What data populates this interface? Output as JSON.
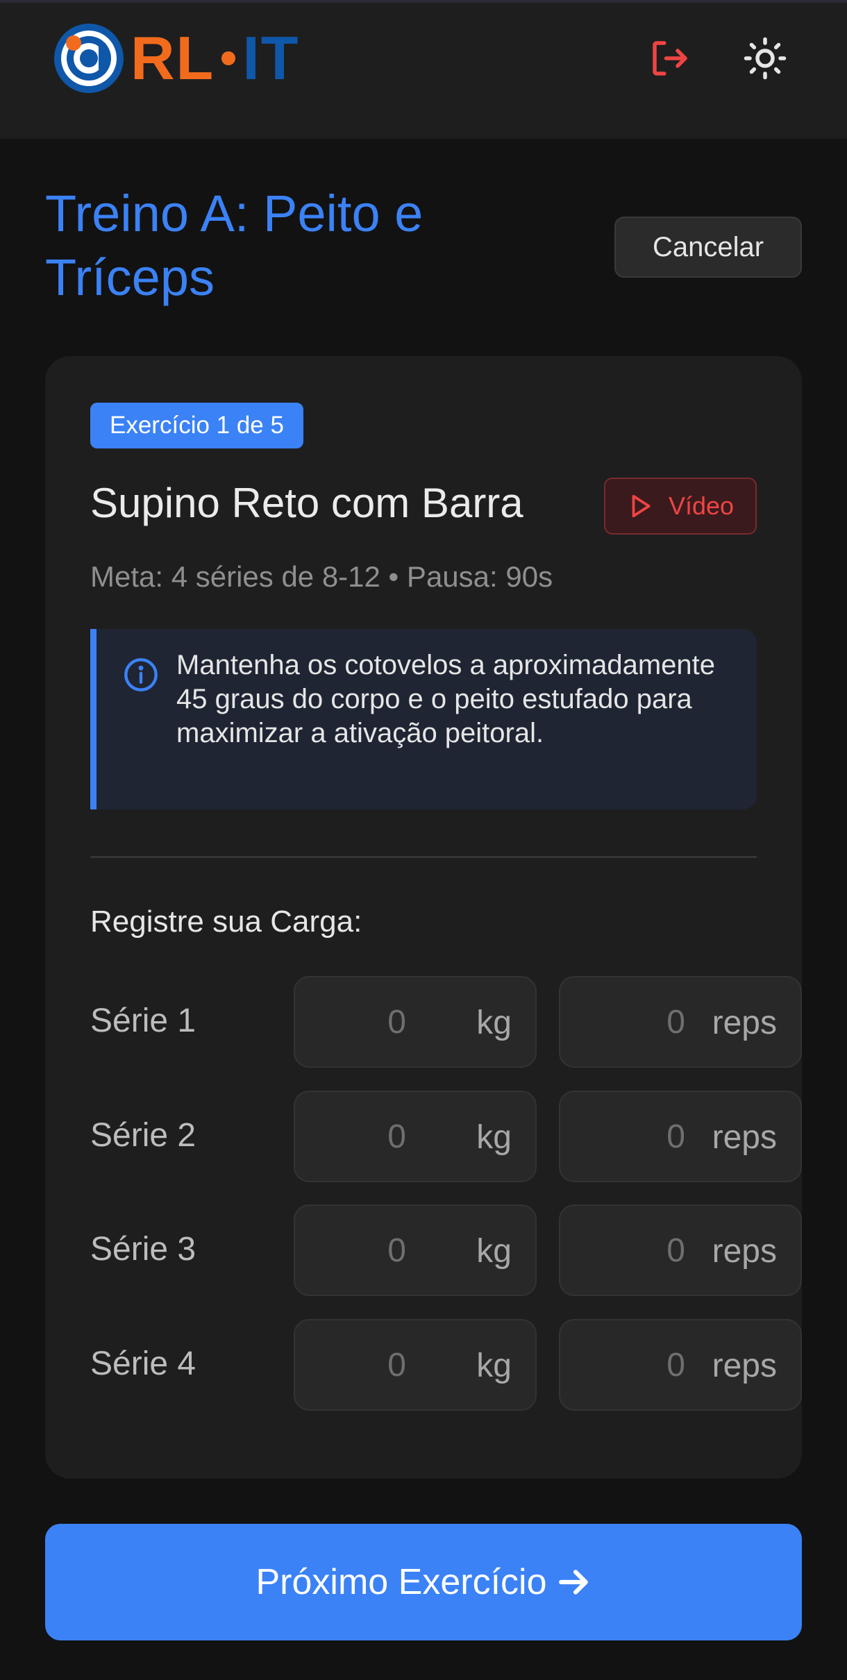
{
  "header": {
    "logo_prefix": "RL",
    "logo_suffix": "IT",
    "logout_icon": "logout-icon",
    "theme_icon": "sun-icon"
  },
  "page": {
    "title_line1": "Treino A: Peito e",
    "title_line2": "Tríceps",
    "cancel_label": "Cancelar"
  },
  "exercise": {
    "badge": "Exercício 1 de 5",
    "name": "Supino Reto com Barra",
    "video_label": "Vídeo",
    "meta": "Meta: 4 séries de 8-12 • Pausa: 90s",
    "tip": "Mantenha os cotovelos a aproximadamente 45 graus do corpo e o peito estufado para maximizar a ativação peitoral."
  },
  "log": {
    "label": "Registre sua Carga:",
    "sets": [
      {
        "label": "Série 1",
        "kg_placeholder": "0",
        "kg_unit": "kg",
        "reps_placeholder": "0",
        "reps_unit": "reps"
      },
      {
        "label": "Série 2",
        "kg_placeholder": "0",
        "kg_unit": "kg",
        "reps_placeholder": "0",
        "reps_unit": "reps"
      },
      {
        "label": "Série 3",
        "kg_placeholder": "0",
        "kg_unit": "kg",
        "reps_placeholder": "0",
        "reps_unit": "reps"
      },
      {
        "label": "Série 4",
        "kg_placeholder": "0",
        "kg_unit": "kg",
        "reps_placeholder": "0",
        "reps_unit": "reps"
      }
    ]
  },
  "footer": {
    "next_label": "Próximo Exercício",
    "next_icon": "arrow-right-icon"
  },
  "colors": {
    "accent": "#3b82f6",
    "danger": "#ef4444",
    "logo_orange": "#f26b1d",
    "logo_blue": "#0f57a8"
  }
}
